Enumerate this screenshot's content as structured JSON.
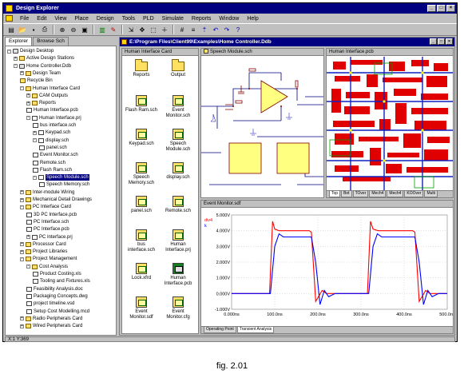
{
  "app": {
    "title": "Design Explorer"
  },
  "menu": [
    "File",
    "Edit",
    "View",
    "Place",
    "Design",
    "Tools",
    "PLD",
    "Simulate",
    "Reports",
    "Window",
    "Help"
  ],
  "left_tabs": [
    "Explorer",
    "Browse Sch"
  ],
  "tree": [
    {
      "label": "Design Desktop",
      "depth": 0,
      "icon": "desktop-icon",
      "exp": "-"
    },
    {
      "label": "Active Design Stations",
      "depth": 1,
      "icon": "folder-icon",
      "exp": "+"
    },
    {
      "label": "Home Controller.Ddb",
      "depth": 1,
      "icon": "database-icon",
      "exp": "-"
    },
    {
      "label": "Design Team",
      "depth": 2,
      "icon": "folder-icon",
      "exp": "+"
    },
    {
      "label": "Recycle Bin",
      "depth": 2,
      "icon": "folder-icon",
      "exp": ""
    },
    {
      "label": "Human Interface Card",
      "depth": 2,
      "icon": "folder-icon",
      "exp": "-"
    },
    {
      "label": "CAM Outputs",
      "depth": 3,
      "icon": "folder-icon",
      "exp": "+"
    },
    {
      "label": "Reports",
      "depth": 3,
      "icon": "folder-icon",
      "exp": "+"
    },
    {
      "label": "Human Interface.pcb",
      "depth": 3,
      "icon": "doc-icon",
      "exp": ""
    },
    {
      "label": "Human Interface.prj",
      "depth": 3,
      "icon": "doc-icon",
      "exp": "-"
    },
    {
      "label": "bus interface.sch",
      "depth": 4,
      "icon": "doc-icon",
      "exp": ""
    },
    {
      "label": "Keypad.sch",
      "depth": 4,
      "icon": "doc-icon",
      "exp": "+"
    },
    {
      "label": "display.sch",
      "depth": 4,
      "icon": "doc-icon",
      "exp": "-"
    },
    {
      "label": "panel.sch",
      "depth": 5,
      "icon": "doc-icon",
      "exp": ""
    },
    {
      "label": "Event Monitor.sch",
      "depth": 4,
      "icon": "doc-icon",
      "exp": ""
    },
    {
      "label": "Remote.sch",
      "depth": 4,
      "icon": "doc-icon",
      "exp": ""
    },
    {
      "label": "Flash Ram.sch",
      "depth": 4,
      "icon": "doc-icon",
      "exp": ""
    },
    {
      "label": "Speech Module.sch",
      "depth": 4,
      "icon": "doc-icon",
      "exp": "-",
      "selected": true
    },
    {
      "label": "Speech Memory.sch",
      "depth": 5,
      "icon": "doc-icon",
      "exp": ""
    },
    {
      "label": "Inter-module Wiring",
      "depth": 2,
      "icon": "folder-icon",
      "exp": "+"
    },
    {
      "label": "Mechanical Detail Drawings",
      "depth": 2,
      "icon": "folder-icon",
      "exp": "+"
    },
    {
      "label": "PC Interface Card",
      "depth": 2,
      "icon": "folder-icon",
      "exp": "-"
    },
    {
      "label": "3D PC Interface.pcb",
      "depth": 3,
      "icon": "doc-icon",
      "exp": ""
    },
    {
      "label": "PC Interface.sch",
      "depth": 3,
      "icon": "doc-icon",
      "exp": ""
    },
    {
      "label": "PC Interface.pcb",
      "depth": 3,
      "icon": "doc-icon",
      "exp": ""
    },
    {
      "label": "PC Interface.prj",
      "depth": 3,
      "icon": "doc-icon",
      "exp": "+"
    },
    {
      "label": "Processor Card",
      "depth": 2,
      "icon": "folder-icon",
      "exp": "+"
    },
    {
      "label": "Project Libraries",
      "depth": 2,
      "icon": "folder-icon",
      "exp": "+"
    },
    {
      "label": "Project Management",
      "depth": 2,
      "icon": "folder-icon",
      "exp": "-"
    },
    {
      "label": "Cost Analysis",
      "depth": 3,
      "icon": "folder-icon",
      "exp": "-"
    },
    {
      "label": "Product Costing.xls",
      "depth": 4,
      "icon": "doc-icon",
      "exp": ""
    },
    {
      "label": "Tooling and Fixtures.xls",
      "depth": 4,
      "icon": "doc-icon",
      "exp": ""
    },
    {
      "label": "Feasibility Analysis.doc",
      "depth": 3,
      "icon": "doc-icon",
      "exp": ""
    },
    {
      "label": "Packaging Concepts.dwg",
      "depth": 3,
      "icon": "doc-icon",
      "exp": ""
    },
    {
      "label": "project timeline.vsd",
      "depth": 3,
      "icon": "doc-icon",
      "exp": ""
    },
    {
      "label": "Setup Cost Modelling.mcd",
      "depth": 3,
      "icon": "doc-icon",
      "exp": ""
    },
    {
      "label": "Radio Peripherals Card",
      "depth": 2,
      "icon": "folder-icon",
      "exp": "+"
    },
    {
      "label": "Wired Peripherals Card",
      "depth": 2,
      "icon": "folder-icon",
      "exp": "+"
    }
  ],
  "status": "X:1 Y:369",
  "docwin": {
    "title": "E:\\Program Files\\Client99\\Examples\\Home Controller.Ddb"
  },
  "panes": {
    "folder": "Human Interface Card",
    "schematic": "Speech Module.sch",
    "pcb": "Human Interface.pcb",
    "sim": "Event Monitor.sdf"
  },
  "files": [
    {
      "label": "Reports",
      "kind": "folder"
    },
    {
      "label": "Output",
      "kind": "folder"
    },
    {
      "label": "Flash Ram.sch",
      "kind": "sch"
    },
    {
      "label": "Event Monitor.sch",
      "kind": "sch"
    },
    {
      "label": "Keypad.sch",
      "kind": "sch"
    },
    {
      "label": "Speech Module.sch",
      "kind": "sch"
    },
    {
      "label": "Speech Memory.sch",
      "kind": "sch"
    },
    {
      "label": "display.sch",
      "kind": "sch"
    },
    {
      "label": "panel.sch",
      "kind": "sch"
    },
    {
      "label": "Remote.sch",
      "kind": "sch"
    },
    {
      "label": "bus interface.sch",
      "kind": "sch"
    },
    {
      "label": "Human Interface.prj",
      "kind": "sch"
    },
    {
      "label": "Lock.xfrd",
      "kind": "sch"
    },
    {
      "label": "Human Interface.pcb",
      "kind": "pcb"
    },
    {
      "label": "Event Monitor.sdf",
      "kind": "sch"
    },
    {
      "label": "Event Monitor.cfg",
      "kind": "sch"
    }
  ],
  "pcb_tabs": [
    "Top",
    "Bot",
    "TOver",
    "Mech4",
    "Mech4",
    "KOOver",
    "Multi"
  ],
  "sim_tabs": [
    "Operating Point",
    "Transient Analysis"
  ],
  "chart_data": {
    "type": "line",
    "xlabel": "",
    "ylabel": "",
    "x_ticks": [
      "0.000ns",
      "100.0ns",
      "200.0ns",
      "300.0ns",
      "400.0ns",
      "500.0ns"
    ],
    "y_ticks": [
      "5.000V",
      "4.000V",
      "3.000V",
      "2.000V",
      "1.000V",
      "0.000V",
      "-1.000V"
    ],
    "xlim": [
      0,
      500
    ],
    "ylim": [
      -1,
      5
    ],
    "grid": true,
    "series": [
      {
        "name": "div4",
        "color": "#ff0000",
        "x": [
          0,
          88,
          95,
          100,
          110,
          180,
          185,
          195,
          210,
          220,
          230,
          250,
          315,
          322,
          328,
          340,
          420,
          425,
          435,
          450,
          460,
          470,
          500
        ],
        "y": [
          0,
          0,
          4.6,
          4.1,
          4.0,
          4.0,
          3.9,
          -0.5,
          0.2,
          0.0,
          0.0,
          0,
          0,
          4.6,
          4.1,
          4.0,
          4.0,
          3.9,
          -0.5,
          0.2,
          0.0,
          0.0,
          0
        ]
      },
      {
        "name": "k",
        "color": "#0000ff",
        "x": [
          0,
          90,
          100,
          110,
          120,
          185,
          195,
          205,
          215,
          225,
          240,
          250,
          318,
          328,
          338,
          348,
          425,
          435,
          445,
          455,
          465,
          480,
          500
        ],
        "y": [
          0,
          0,
          3.0,
          3.8,
          3.6,
          3.6,
          2.0,
          -0.7,
          0.2,
          -0.2,
          0.0,
          0,
          0,
          3.0,
          3.8,
          3.6,
          3.6,
          2.0,
          -0.7,
          0.2,
          -0.2,
          0.0,
          0
        ]
      }
    ]
  },
  "caption": "fig. 2.01",
  "colors": {
    "titlebar": "#000080",
    "pcb_bg": "#ffffff",
    "pcb_trace_red": "#e00000",
    "pcb_trace_blue": "#1020c0",
    "pcb_green": "#00a000"
  }
}
